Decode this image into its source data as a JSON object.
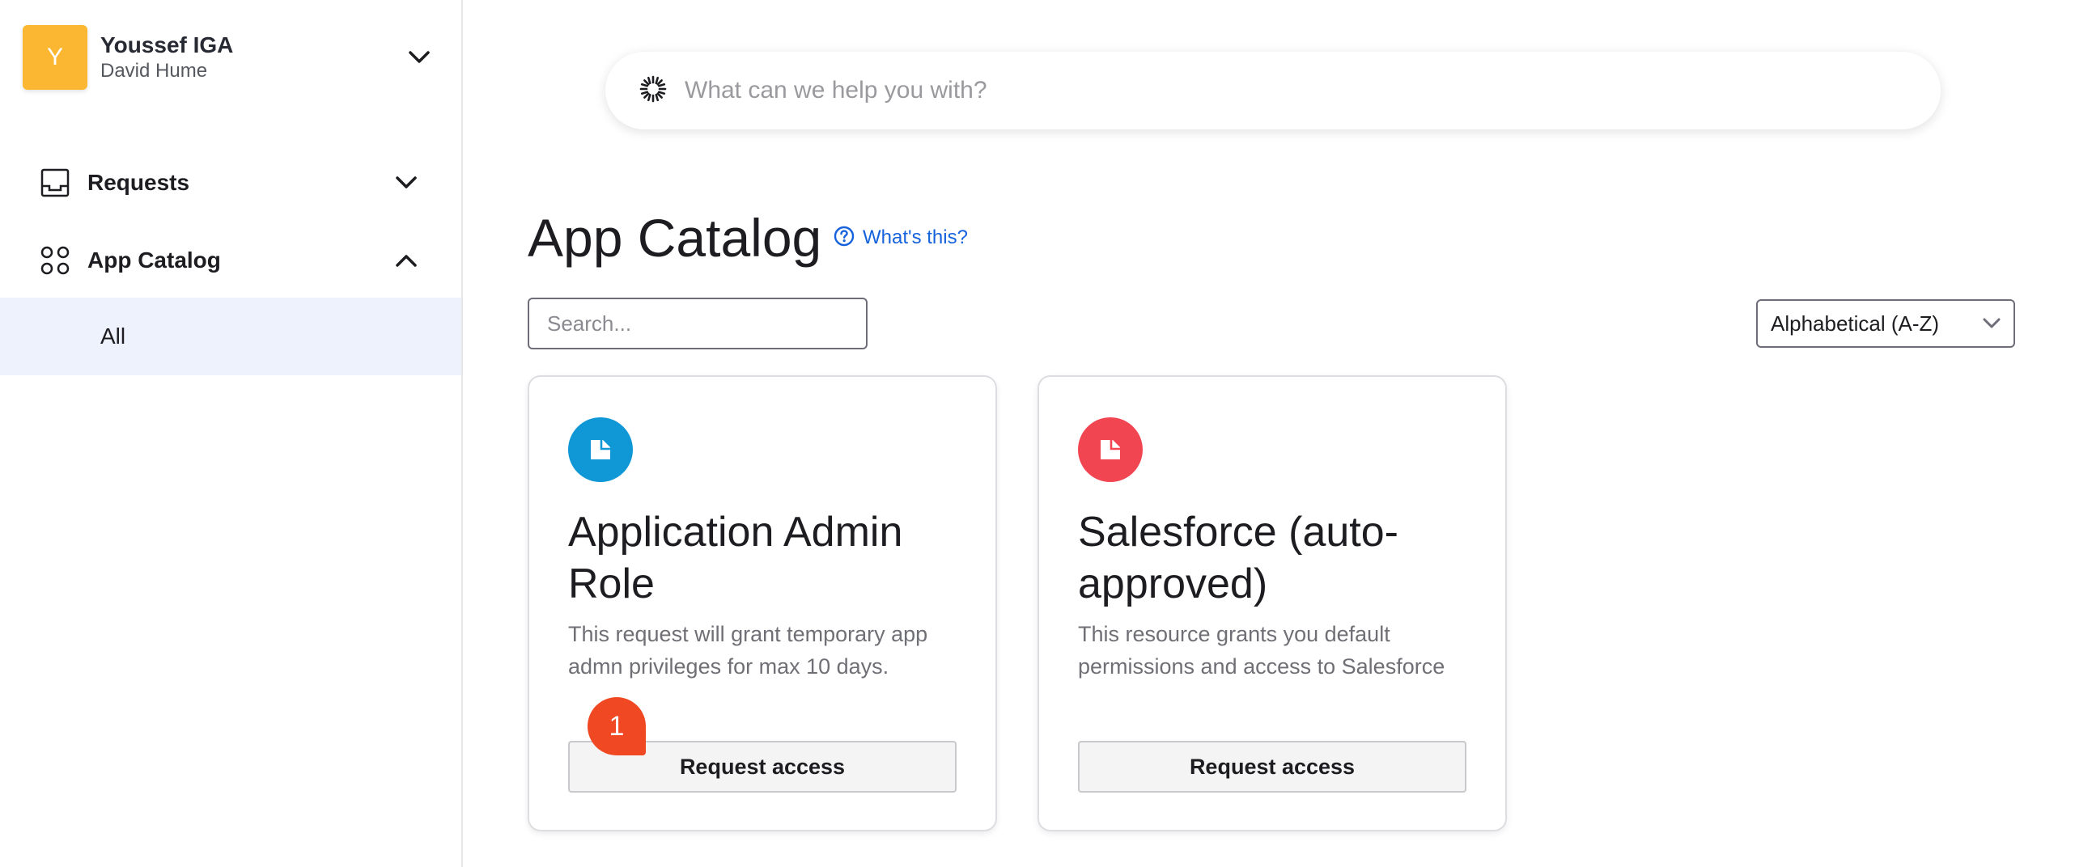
{
  "sidebar": {
    "org": {
      "avatar_letter": "Y",
      "name": "Youssef IGA",
      "user": "David Hume",
      "avatar_color": "#fbb731"
    },
    "nav": [
      {
        "label": "Requests",
        "icon": "inbox-icon",
        "expanded": false
      },
      {
        "label": "App Catalog",
        "icon": "apps-grid-icon",
        "expanded": true
      }
    ],
    "sub_item": {
      "label": "All",
      "selected": true
    }
  },
  "search": {
    "placeholder": "What can we help you with?"
  },
  "main": {
    "title": "App Catalog",
    "whats_this": "What's this?",
    "catalog_search_placeholder": "Search...",
    "sort": {
      "selected": "Alphabetical (A-Z)"
    }
  },
  "cards": [
    {
      "title": "Application Admin Role",
      "description": "This request will grant temporary app admn privileges for max 10 days.",
      "button": "Request access",
      "icon": "document-icon",
      "icon_color": "#0f97d6"
    },
    {
      "title": "Salesforce (auto-approved)",
      "description": "This resource grants you default permissions and access to Salesforce",
      "button": "Request access",
      "icon": "document-icon",
      "icon_color": "#f24552"
    }
  ],
  "step_badge": {
    "label": "1",
    "color": "#ef4822"
  },
  "colors": {
    "accent_link": "#1662dd",
    "selected_bg": "#eef2fc"
  }
}
